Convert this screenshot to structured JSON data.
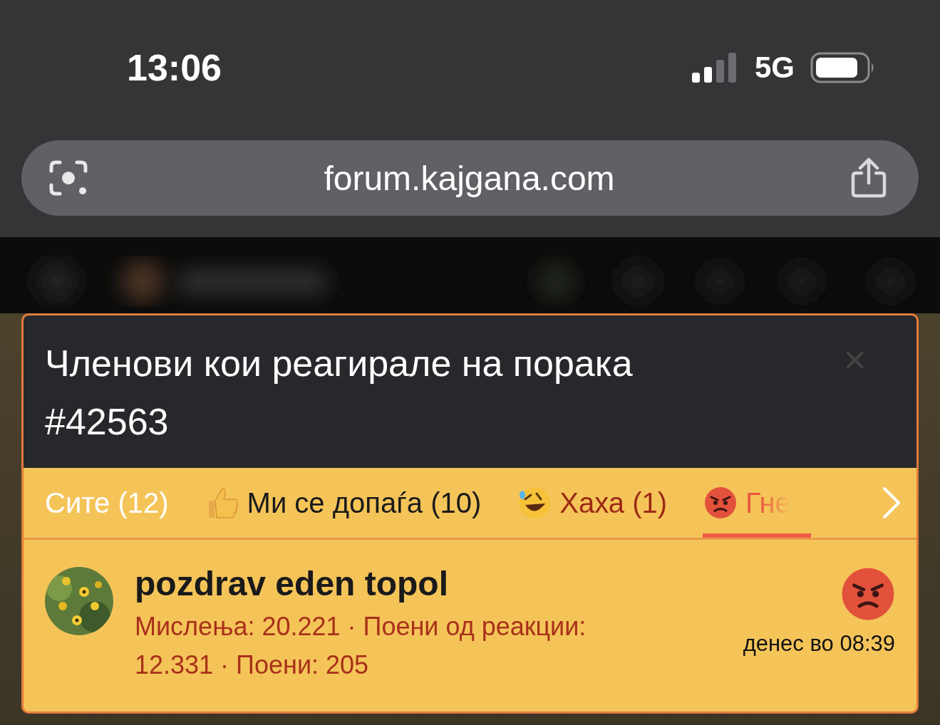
{
  "status_bar": {
    "time": "13:06",
    "network": "5G"
  },
  "address_bar": {
    "url": "forum.kajgana.com"
  },
  "dialog": {
    "title": "Членови кои реагирале на порака #42563",
    "close": "×",
    "tabs": [
      {
        "kind": "plain",
        "label": "Сите (12)",
        "color": "#ffffff",
        "selected": false
      },
      {
        "kind": "thumbs",
        "label": "Ми се допаѓа (10)",
        "color": "#1a1a1a",
        "selected": false
      },
      {
        "kind": "laugh",
        "label": "Хаха (1)",
        "color": "#9c2a14",
        "selected": false
      },
      {
        "kind": "angry",
        "label": "Гне",
        "color": "#e8553e",
        "selected": true
      }
    ],
    "members": [
      {
        "name": "pozdrav eden topol",
        "stats": "Мислења: 20.221 · Поени од реакции: 12.331 · Поени: 205",
        "kind": "angry",
        "time": "денес во 08:39"
      }
    ]
  }
}
